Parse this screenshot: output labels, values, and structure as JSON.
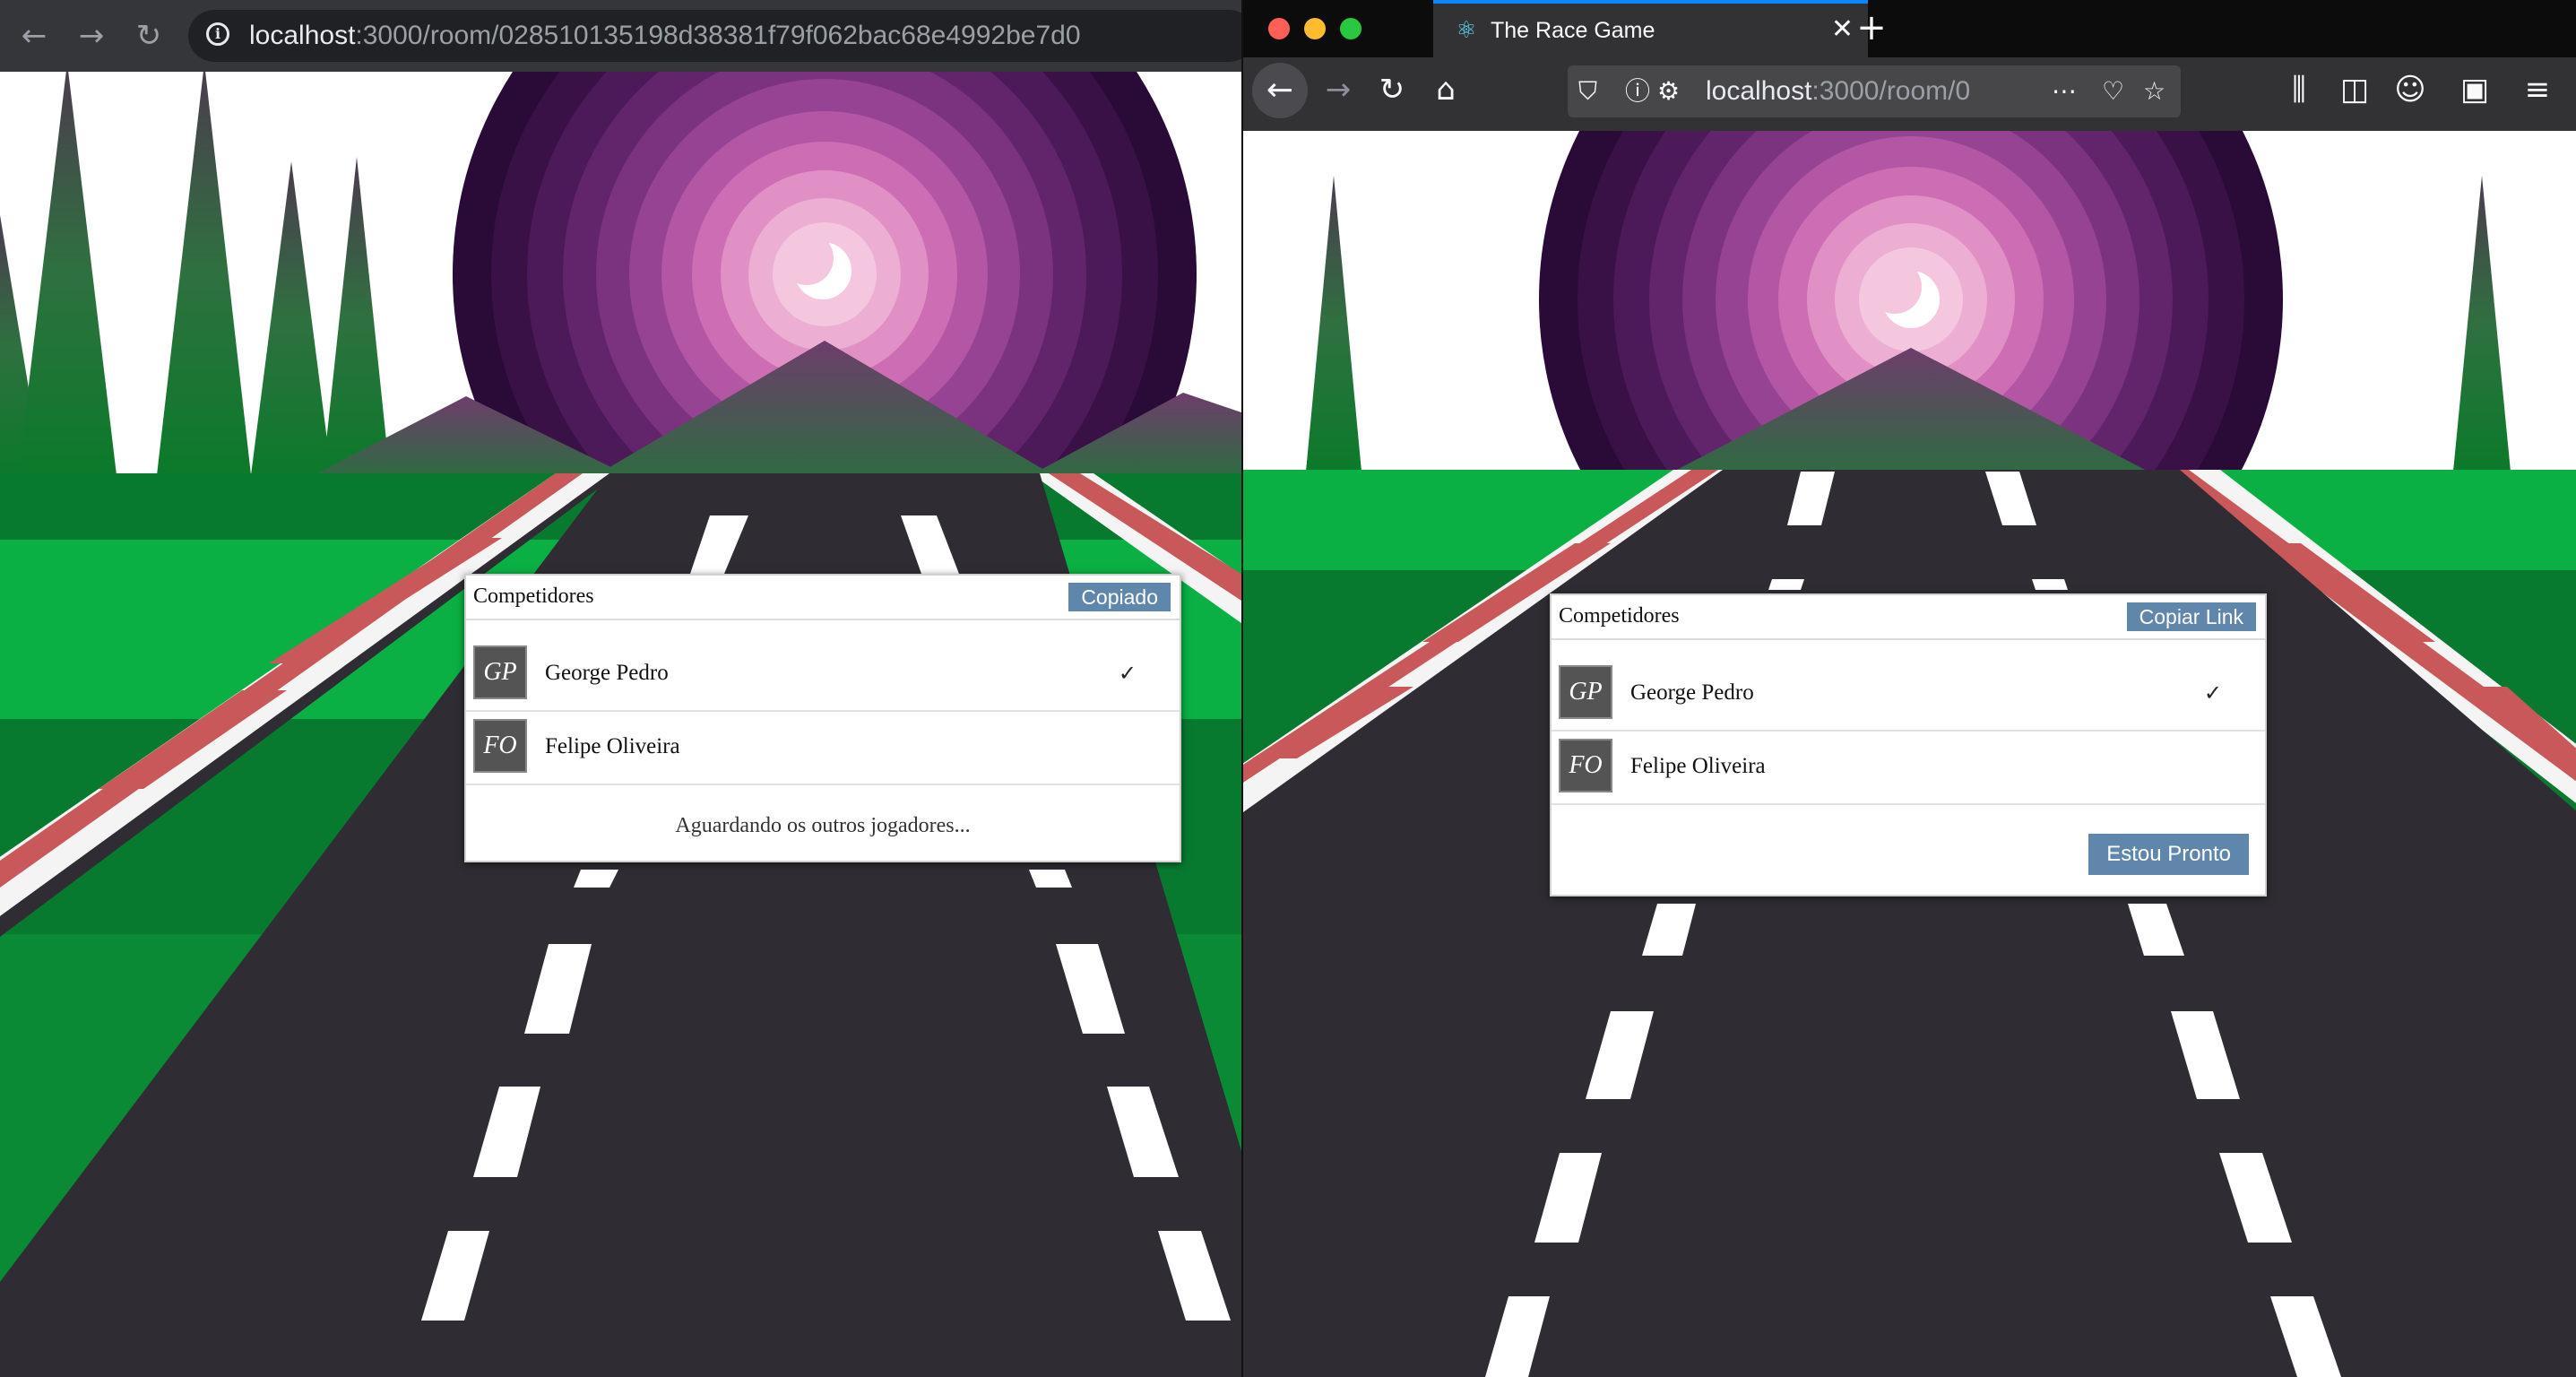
{
  "left_window": {
    "toolbar": {
      "back_icon": "arrow-left-icon",
      "forward_icon": "arrow-right-icon",
      "reload_icon": "reload-icon",
      "url_host": "localhost",
      "url_path": ":3000/room/028510135198d38381f79f062bac68e4992be7d0"
    },
    "lobby": {
      "title": "Competidores",
      "copy_button": "Copiado",
      "players": [
        {
          "initials": "GP",
          "name": "George Pedro",
          "ready_mark": "✓"
        },
        {
          "initials": "FO",
          "name": "Felipe Oliveira",
          "ready_mark": ""
        }
      ],
      "footer_text": "Aguardando os outros jogadores..."
    }
  },
  "right_window": {
    "tab": {
      "title": "The Race Game",
      "icon": "react-icon"
    },
    "toolbar": {
      "url_host": "localhost",
      "url_path": ":3000/room/0"
    },
    "lobby": {
      "title": "Competidores",
      "copy_button": "Copiar Link",
      "players": [
        {
          "initials": "GP",
          "name": "George Pedro",
          "ready_mark": "✓"
        },
        {
          "initials": "FO",
          "name": "Felipe Oliveira",
          "ready_mark": ""
        }
      ],
      "ready_button": "Estou Pronto"
    }
  },
  "colors": {
    "accent_button": "#5f87ab",
    "road": "#2f2d33",
    "grass": "#0ab043",
    "grass_dark": "#087a30",
    "curb_red": "#c8585a",
    "sun_outer": "#2a0b37",
    "sun_inner": "#f4c7de"
  }
}
